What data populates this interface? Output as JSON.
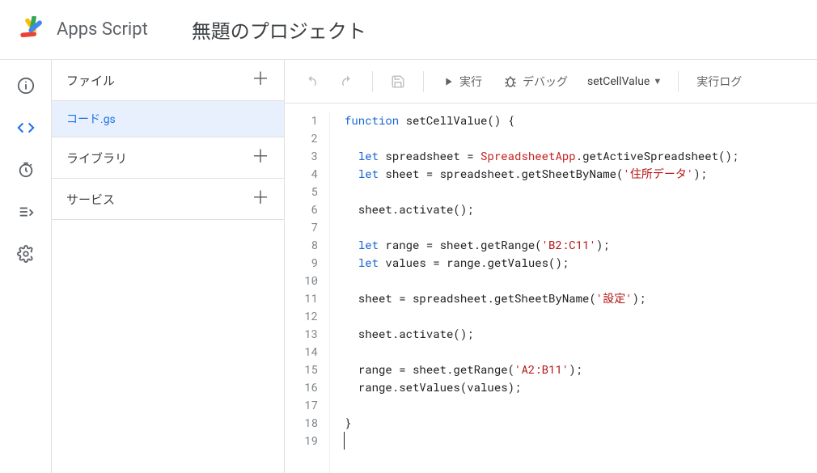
{
  "header": {
    "brand": "Apps Script",
    "project_title": "無題のプロジェクト"
  },
  "rail": {
    "items": [
      "info",
      "editor",
      "triggers",
      "executions",
      "settings"
    ],
    "active_index": 1
  },
  "sidebar": {
    "files_label": "ファイル",
    "files": [
      {
        "name": "コード.gs",
        "selected": true
      }
    ],
    "library_label": "ライブラリ",
    "services_label": "サービス"
  },
  "toolbar": {
    "run_label": "実行",
    "debug_label": "デバッグ",
    "function_selected": "setCellValue",
    "log_label": "実行ログ"
  },
  "editor": {
    "line_count": 19,
    "code_lines": [
      [
        {
          "t": "function ",
          "c": "kw"
        },
        {
          "t": "setCellValue",
          "c": "fn"
        },
        {
          "t": "() {",
          "c": ""
        }
      ],
      [
        {
          "t": "",
          "c": ""
        }
      ],
      [
        {
          "t": "  ",
          "c": ""
        },
        {
          "t": "let ",
          "c": "kw"
        },
        {
          "t": "spreadsheet = ",
          "c": ""
        },
        {
          "t": "SpreadsheetApp",
          "c": "cls"
        },
        {
          "t": ".getActiveSpreadsheet();",
          "c": ""
        }
      ],
      [
        {
          "t": "  ",
          "c": ""
        },
        {
          "t": "let ",
          "c": "kw"
        },
        {
          "t": "sheet = spreadsheet.getSheetByName(",
          "c": ""
        },
        {
          "t": "'住所データ'",
          "c": "str"
        },
        {
          "t": ");",
          "c": ""
        }
      ],
      [
        {
          "t": "",
          "c": ""
        }
      ],
      [
        {
          "t": "  sheet.activate();",
          "c": ""
        }
      ],
      [
        {
          "t": "",
          "c": ""
        }
      ],
      [
        {
          "t": "  ",
          "c": ""
        },
        {
          "t": "let ",
          "c": "kw"
        },
        {
          "t": "range = sheet.getRange(",
          "c": ""
        },
        {
          "t": "'B2:C11'",
          "c": "str"
        },
        {
          "t": ");",
          "c": ""
        }
      ],
      [
        {
          "t": "  ",
          "c": ""
        },
        {
          "t": "let ",
          "c": "kw"
        },
        {
          "t": "values = range.getValues();",
          "c": ""
        }
      ],
      [
        {
          "t": "",
          "c": ""
        }
      ],
      [
        {
          "t": "  sheet = spreadsheet.getSheetByName(",
          "c": ""
        },
        {
          "t": "'設定'",
          "c": "str"
        },
        {
          "t": ");",
          "c": ""
        }
      ],
      [
        {
          "t": "",
          "c": ""
        }
      ],
      [
        {
          "t": "  sheet.activate();",
          "c": ""
        }
      ],
      [
        {
          "t": "",
          "c": ""
        }
      ],
      [
        {
          "t": "  range = sheet.getRange(",
          "c": ""
        },
        {
          "t": "'A2:B11'",
          "c": "str"
        },
        {
          "t": ");",
          "c": ""
        }
      ],
      [
        {
          "t": "  range.setValues(values);",
          "c": ""
        }
      ],
      [
        {
          "t": "",
          "c": ""
        }
      ],
      [
        {
          "t": "}",
          "c": ""
        }
      ],
      [
        {
          "t": "",
          "c": ""
        }
      ]
    ]
  }
}
